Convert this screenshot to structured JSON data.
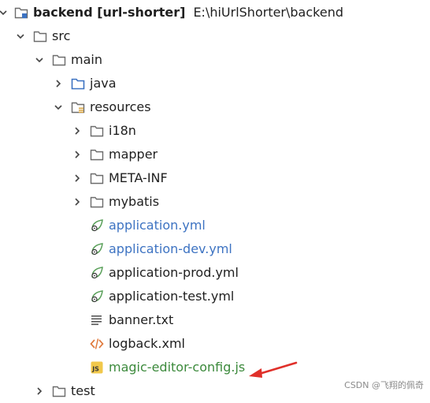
{
  "tree": {
    "root": {
      "name": "backend",
      "module": "[url-shorter]",
      "path": "E:\\hiUrlShorter\\backend"
    },
    "items": [
      {
        "label": "src"
      },
      {
        "label": "main"
      },
      {
        "label": "java"
      },
      {
        "label": "resources"
      },
      {
        "label": "i18n"
      },
      {
        "label": "mapper"
      },
      {
        "label": "META-INF"
      },
      {
        "label": "mybatis"
      },
      {
        "label": "application.yml"
      },
      {
        "label": "application-dev.yml"
      },
      {
        "label": "application-prod.yml"
      },
      {
        "label": "application-test.yml"
      },
      {
        "label": "banner.txt"
      },
      {
        "label": "logback.xml"
      },
      {
        "label": "magic-editor-config.js"
      },
      {
        "label": "test"
      }
    ]
  },
  "watermark": "CSDN @飞翔的佩奇",
  "colors": {
    "folder_stroke": "#6b6b6b",
    "java_folder": "#3d73c2",
    "spring_green": "#5aa05a",
    "xml_orange": "#e07a3c",
    "js_yellow": "#f1c84b",
    "arrow_red": "#e0302a",
    "link_blue": "#3d73c2",
    "text_green": "#3c8a3c"
  }
}
